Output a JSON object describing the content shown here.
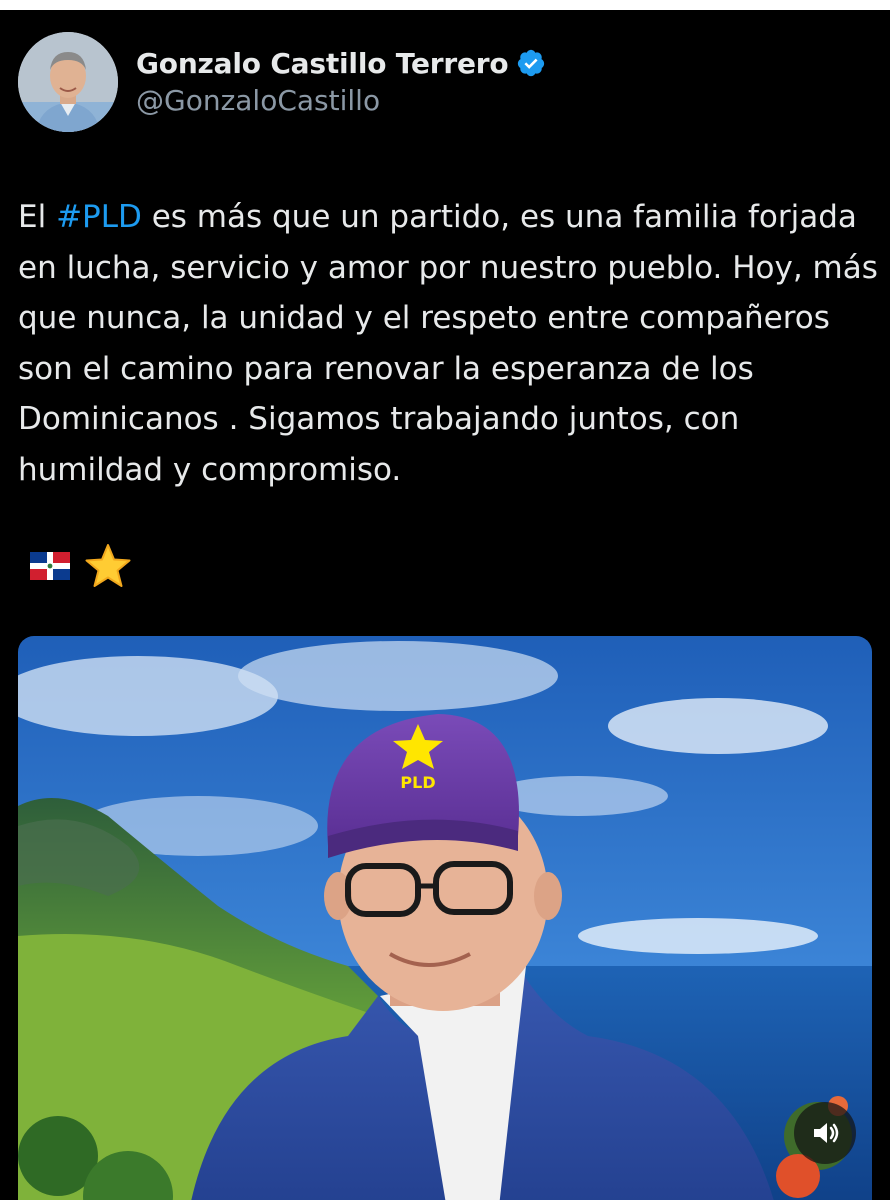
{
  "author": {
    "display_name": "Gonzalo Castillo Terrero",
    "handle": "@GonzaloCastillo",
    "verified": true,
    "avatar_icon": "profile-photo"
  },
  "tweet": {
    "text_prefix": "El ",
    "hashtag": "#PLD",
    "text_body": " es más que un partido, es una familia forjada en lucha, servicio y amor por nuestro pueblo. Hoy, más que nunca, la unidad y el respeto entre compañeros son el camino para renovar la esperanza de los Dominicanos . Sigamos trabajando juntos, con humildad y compromiso.",
    "emojis": [
      "dominican-flag-icon",
      "star-icon"
    ]
  },
  "media": {
    "type": "video",
    "cap_text": "PLD",
    "volume_icon": "speaker-icon"
  },
  "colors": {
    "background": "#000000",
    "text": "#e7e9ea",
    "secondary_text": "#8b98a5",
    "link": "#1d9bf0",
    "verified_badge": "#1d9bf0",
    "cap_purple": "#6a3fa6",
    "star_yellow": "#ffe600"
  }
}
